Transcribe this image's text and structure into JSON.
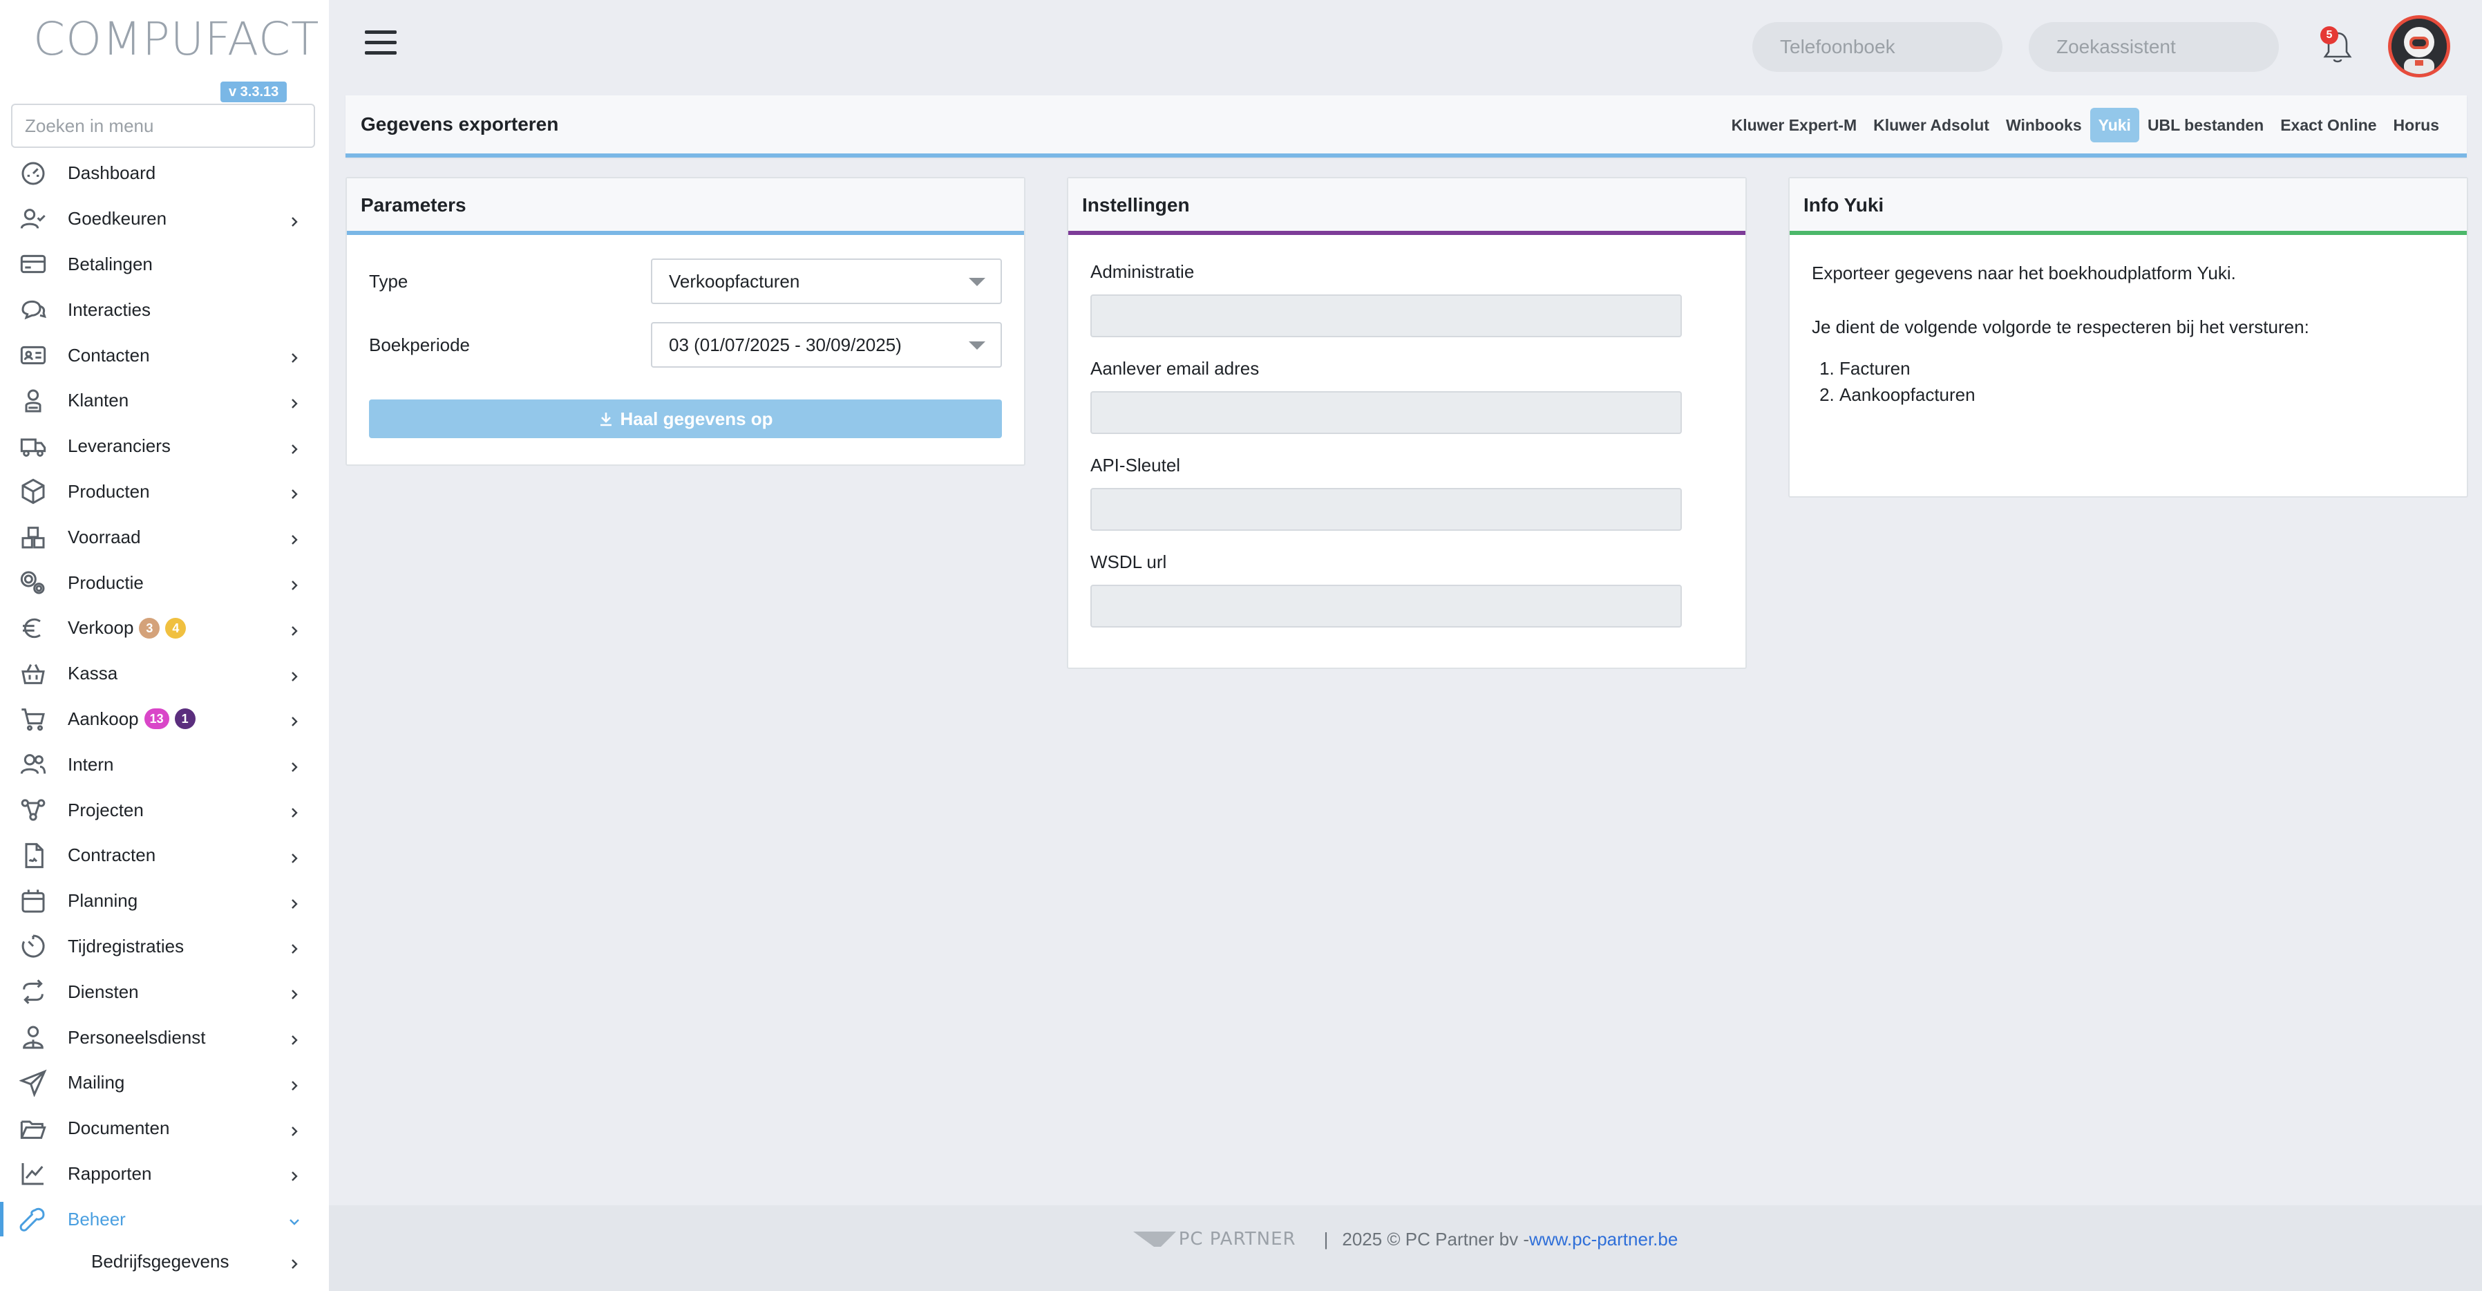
{
  "sidebar": {
    "brand": "COMPUFACT",
    "version": "v 3.3.13",
    "search_placeholder": "Zoeken in menu",
    "items": [
      {
        "label": "Dashboard",
        "icon": "dashboard-icon",
        "chevron": false
      },
      {
        "label": "Goedkeuren",
        "icon": "user-check-icon",
        "chevron": true
      },
      {
        "label": "Betalingen",
        "icon": "credit-card-icon",
        "chevron": false
      },
      {
        "label": "Interacties",
        "icon": "chat-bubbles-icon",
        "chevron": false
      },
      {
        "label": "Contacten",
        "icon": "address-card-icon",
        "chevron": true
      },
      {
        "label": "Klanten",
        "icon": "customer-icon",
        "chevron": true
      },
      {
        "label": "Leveranciers",
        "icon": "truck-icon",
        "chevron": true
      },
      {
        "label": "Producten",
        "icon": "box-icon",
        "chevron": true
      },
      {
        "label": "Voorraad",
        "icon": "boxes-icon",
        "chevron": true
      },
      {
        "label": "Productie",
        "icon": "gears-icon",
        "chevron": true
      },
      {
        "label": "Verkoop",
        "icon": "euro-icon",
        "chevron": true,
        "badges": [
          {
            "text": "3",
            "color": "#d4a27a"
          },
          {
            "text": "4",
            "color": "#f0c040"
          }
        ]
      },
      {
        "label": "Kassa",
        "icon": "basket-icon",
        "chevron": true
      },
      {
        "label": "Aankoop",
        "icon": "cart-icon",
        "chevron": true,
        "badges": [
          {
            "text": "13",
            "color": "#d946c8"
          },
          {
            "text": "1",
            "color": "#5b2e7e"
          }
        ]
      },
      {
        "label": "Intern",
        "icon": "users-icon",
        "chevron": true
      },
      {
        "label": "Projecten",
        "icon": "project-nodes-icon",
        "chevron": true
      },
      {
        "label": "Contracten",
        "icon": "contract-icon",
        "chevron": true
      },
      {
        "label": "Planning",
        "icon": "calendar-icon",
        "chevron": true
      },
      {
        "label": "Tijdregistraties",
        "icon": "timer-icon",
        "chevron": true
      },
      {
        "label": "Diensten",
        "icon": "repeat-icon",
        "chevron": true
      },
      {
        "label": "Personeelsdienst",
        "icon": "personnel-icon",
        "chevron": true
      },
      {
        "label": "Mailing",
        "icon": "paper-plane-icon",
        "chevron": true
      },
      {
        "label": "Documenten",
        "icon": "folder-open-icon",
        "chevron": true
      },
      {
        "label": "Rapporten",
        "icon": "line-chart-icon",
        "chevron": true
      },
      {
        "label": "Beheer",
        "icon": "wrench-icon",
        "chevron": true,
        "active": true
      }
    ],
    "subitems": [
      {
        "label": "Bedrijfsgegevens"
      }
    ]
  },
  "topbar": {
    "phonebook_placeholder": "Telefoonboek",
    "assistant_placeholder": "Zoekassistent",
    "notification_count": "5"
  },
  "header": {
    "title": "Gegevens exporteren",
    "tabs": [
      {
        "label": "Kluwer Expert-M",
        "active": false
      },
      {
        "label": "Kluwer Adsolut",
        "active": false
      },
      {
        "label": "Winbooks",
        "active": false
      },
      {
        "label": "Yuki",
        "active": true
      },
      {
        "label": "UBL bestanden",
        "active": false
      },
      {
        "label": "Exact Online",
        "active": false
      },
      {
        "label": "Horus",
        "active": false
      }
    ]
  },
  "parameters": {
    "title": "Parameters",
    "type_label": "Type",
    "type_value": "Verkoopfacturen",
    "period_label": "Boekperiode",
    "period_value": "03 (01/07/2025 - 30/09/2025)",
    "button_label": "Haal gegevens op"
  },
  "settings": {
    "title": "Instellingen",
    "fields": [
      {
        "label": "Administratie",
        "value": ""
      },
      {
        "label": "Aanlever email adres",
        "value": ""
      },
      {
        "label": "API-Sleutel",
        "value": ""
      },
      {
        "label": "WSDL url",
        "value": ""
      }
    ]
  },
  "info": {
    "title": "Info Yuki",
    "line1": "Exporteer gegevens naar het boekhoudplatform Yuki.",
    "line2": "Je dient de volgende volgorde te respecteren bij het versturen:",
    "steps": [
      "Facturen",
      "Aankoopfacturen"
    ]
  },
  "footer": {
    "logo_text": "PC PARTNER",
    "separator": "|",
    "copyright": "2025 © PC Partner bv - ",
    "link": "www.pc-partner.be"
  },
  "colors": {
    "accent": "#4a9fe0",
    "parameters_border": "#7ab7e6",
    "settings_border": "#7d3c98",
    "info_border": "#4cb86a",
    "active_tab": "#93c7ea"
  }
}
